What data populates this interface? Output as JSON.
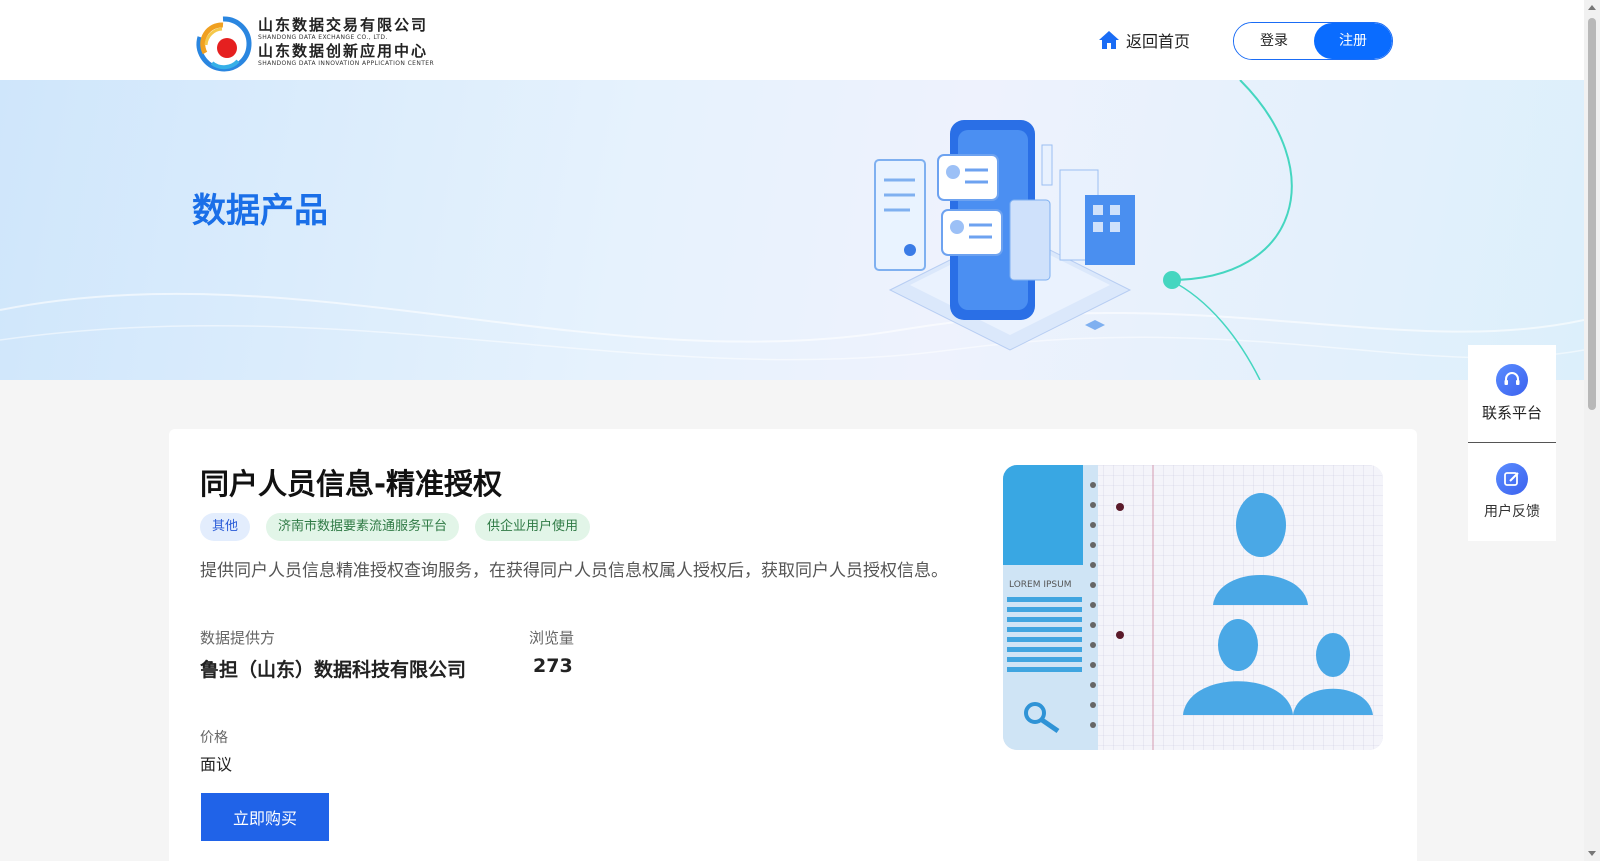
{
  "header": {
    "logo_cn_1": "山东数据交易有限公司",
    "logo_en_1": "SHANDONG DATA EXCHANGE CO., LTD.",
    "logo_cn_2": "山东数据创新应用中心",
    "logo_en_2": "SHANDONG DATA INNOVATION APPLICATION CENTER",
    "home_label": "返回首页",
    "login_label": "登录",
    "register_label": "注册"
  },
  "banner": {
    "title": "数据产品"
  },
  "product": {
    "title": "同户人员信息-精准授权",
    "tags": [
      "其他",
      "济南市数据要素流通服务平台",
      "供企业用户使用"
    ],
    "description": "提供同户人员信息精准授权查询服务，在获得同户人员信息权属人授权后，获取同户人员授权信息。",
    "provider_label": "数据提供方",
    "provider_value": "鲁担（山东）数据科技有限公司",
    "views_label": "浏览量",
    "views_value": "273",
    "price_label": "价格",
    "price_value": "面议",
    "buy_label": "立即购买",
    "image_text": "LOREM IPSUM"
  },
  "side_panel": {
    "contact_label": "联系平台",
    "feedback_label": "用户反馈"
  },
  "colors": {
    "primary": "#0a6cff",
    "banner_title": "#1a6fe8",
    "buy_button": "#2063e8"
  }
}
